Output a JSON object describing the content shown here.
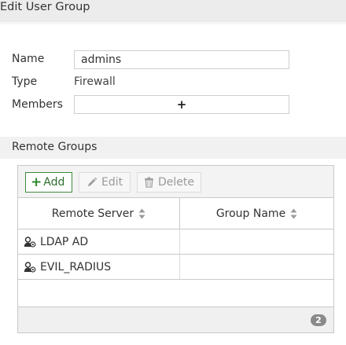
{
  "header": {
    "title": "Edit User Group"
  },
  "form": {
    "name_label": "Name",
    "name_value": "admins",
    "type_label": "Type",
    "type_value": "Firewall",
    "members_label": "Members",
    "members_add_glyph": "+"
  },
  "remote_groups": {
    "section_title": "Remote Groups",
    "toolbar": {
      "add_label": "Add",
      "edit_label": "Edit",
      "delete_label": "Delete"
    },
    "columns": [
      "Remote Server",
      "Group Name"
    ],
    "rows": [
      {
        "remote_server": "LDAP AD",
        "group_name": ""
      },
      {
        "remote_server": "EVIL_RADIUS",
        "group_name": ""
      }
    ],
    "count": "2"
  },
  "colors": {
    "accent_green": "#3f8a3f",
    "header_bg": "#ececec",
    "badge_bg": "#8a8a8a"
  },
  "icons": {
    "add": "plus-icon",
    "edit": "pencil-icon",
    "delete": "trash-icon",
    "sort": "sort-icon",
    "server": "user-server-icon"
  }
}
